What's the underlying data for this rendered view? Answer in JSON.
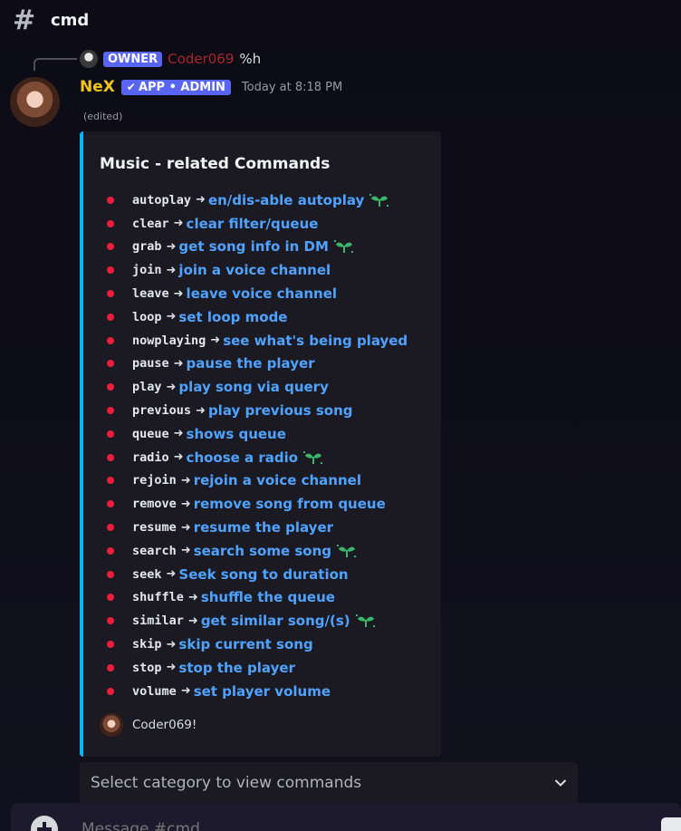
{
  "channel": {
    "name": "cmd"
  },
  "reply": {
    "badge": "OWNER",
    "author": "Coder069",
    "text": "%h"
  },
  "message": {
    "author": "NeX",
    "badge": "APP • ADMIN",
    "timestamp": "Today at 8:18 PM",
    "edited": "(edited)"
  },
  "embed": {
    "title": "Music - related Commands",
    "accent_color": "#0ab4f5",
    "bullet_color": "#ed1e3a",
    "link_color": "#4fa3ff",
    "commands": [
      {
        "name": "autoplay",
        "desc": "en/dis-able autoplay",
        "icon": "sprout-icon"
      },
      {
        "name": "clear",
        "desc": "clear filter/queue",
        "icon": ""
      },
      {
        "name": "grab",
        "desc": "get song info in DM",
        "icon": "sprout-icon"
      },
      {
        "name": "join",
        "desc": "join a voice channel",
        "icon": ""
      },
      {
        "name": "leave",
        "desc": "leave voice channel",
        "icon": ""
      },
      {
        "name": "loop",
        "desc": "set loop mode",
        "icon": ""
      },
      {
        "name": "nowplaying",
        "desc": "see what's being played",
        "icon": ""
      },
      {
        "name": "pause",
        "desc": "pause the player",
        "icon": ""
      },
      {
        "name": "play",
        "desc": "play song via query",
        "icon": ""
      },
      {
        "name": "previous",
        "desc": "play previous song",
        "icon": ""
      },
      {
        "name": "queue",
        "desc": "shows queue",
        "icon": ""
      },
      {
        "name": "radio",
        "desc": "choose a radio",
        "icon": "sprout-icon"
      },
      {
        "name": "rejoin",
        "desc": "rejoin a voice channel",
        "icon": ""
      },
      {
        "name": "remove",
        "desc": "remove song from queue",
        "icon": ""
      },
      {
        "name": "resume",
        "desc": "resume the player",
        "icon": ""
      },
      {
        "name": "search",
        "desc": "search some song",
        "icon": "sprout-icon"
      },
      {
        "name": "seek",
        "desc": "Seek song to duration",
        "icon": ""
      },
      {
        "name": "shuffle",
        "desc": "shuffle the queue",
        "icon": ""
      },
      {
        "name": "similar",
        "desc": "get similar song/(s)",
        "icon": "sprout-icon"
      },
      {
        "name": "skip",
        "desc": "skip current song",
        "icon": ""
      },
      {
        "name": "stop",
        "desc": "stop the player",
        "icon": ""
      },
      {
        "name": "volume",
        "desc": "set player volume",
        "icon": ""
      }
    ],
    "footer": "Coder069!"
  },
  "select": {
    "placeholder": "Select category to view commands"
  },
  "composer": {
    "placeholder": "Message #cmd"
  }
}
